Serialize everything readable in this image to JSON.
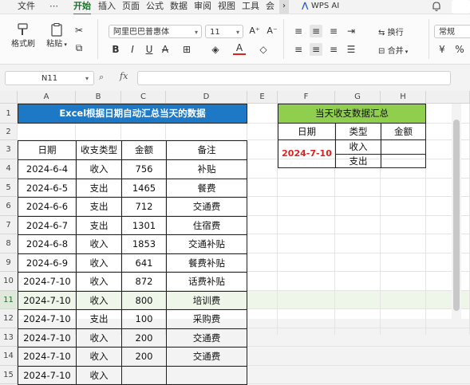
{
  "menu": {
    "items": [
      "文件",
      "⋯",
      "开始",
      "插入",
      "页面",
      "公式",
      "数据",
      "审阅",
      "视图",
      "工具",
      "会"
    ],
    "active": "开始",
    "wps_ai": "WPS AI"
  },
  "ribbon": {
    "format_painter": "格式刷",
    "paste": "粘贴",
    "font_name": "阿里巴巴普惠体",
    "font_size": "11",
    "wrap": "换行",
    "merge": "合并",
    "number_format": "常规"
  },
  "formula_bar": {
    "cell_ref": "N11",
    "fx": "fx"
  },
  "columns": [
    "A",
    "B",
    "C",
    "D",
    "E",
    "F",
    "G",
    "H"
  ],
  "rows": [
    "1",
    "2",
    "3",
    "4",
    "5",
    "6",
    "7",
    "8",
    "9",
    "10",
    "11",
    "12",
    "13",
    "14",
    "15"
  ],
  "selected_row": "11",
  "main_table": {
    "title": "Excel根据日期自动汇总当天的数据",
    "headers": [
      "日期",
      "收支类型",
      "金额",
      "备注"
    ],
    "rows": [
      [
        "2024-6-4",
        "收入",
        "756",
        "补贴"
      ],
      [
        "2024-6-5",
        "支出",
        "1465",
        "餐费"
      ],
      [
        "2024-6-6",
        "支出",
        "712",
        "交通费"
      ],
      [
        "2024-6-7",
        "支出",
        "1301",
        "住宿费"
      ],
      [
        "2024-6-8",
        "收入",
        "1853",
        "交通补贴"
      ],
      [
        "2024-6-9",
        "收入",
        "641",
        "餐费补贴"
      ],
      [
        "2024-7-10",
        "收入",
        "872",
        "话费补贴"
      ],
      [
        "2024-7-10",
        "收入",
        "800",
        "培训费"
      ],
      [
        "2024-7-10",
        "支出",
        "100",
        "采购费"
      ],
      [
        "2024-7-10",
        "收入",
        "200",
        "交通费"
      ],
      [
        "2024-7-10",
        "收入",
        "200",
        "交通费"
      ],
      [
        "2024-7-10",
        "收入",
        "",
        ""
      ]
    ]
  },
  "summary_table": {
    "title": "当天收支数据汇总",
    "headers": [
      "日期",
      "类型",
      "金额"
    ],
    "date": "2024-7-10",
    "types": [
      "收入",
      "支出"
    ]
  }
}
